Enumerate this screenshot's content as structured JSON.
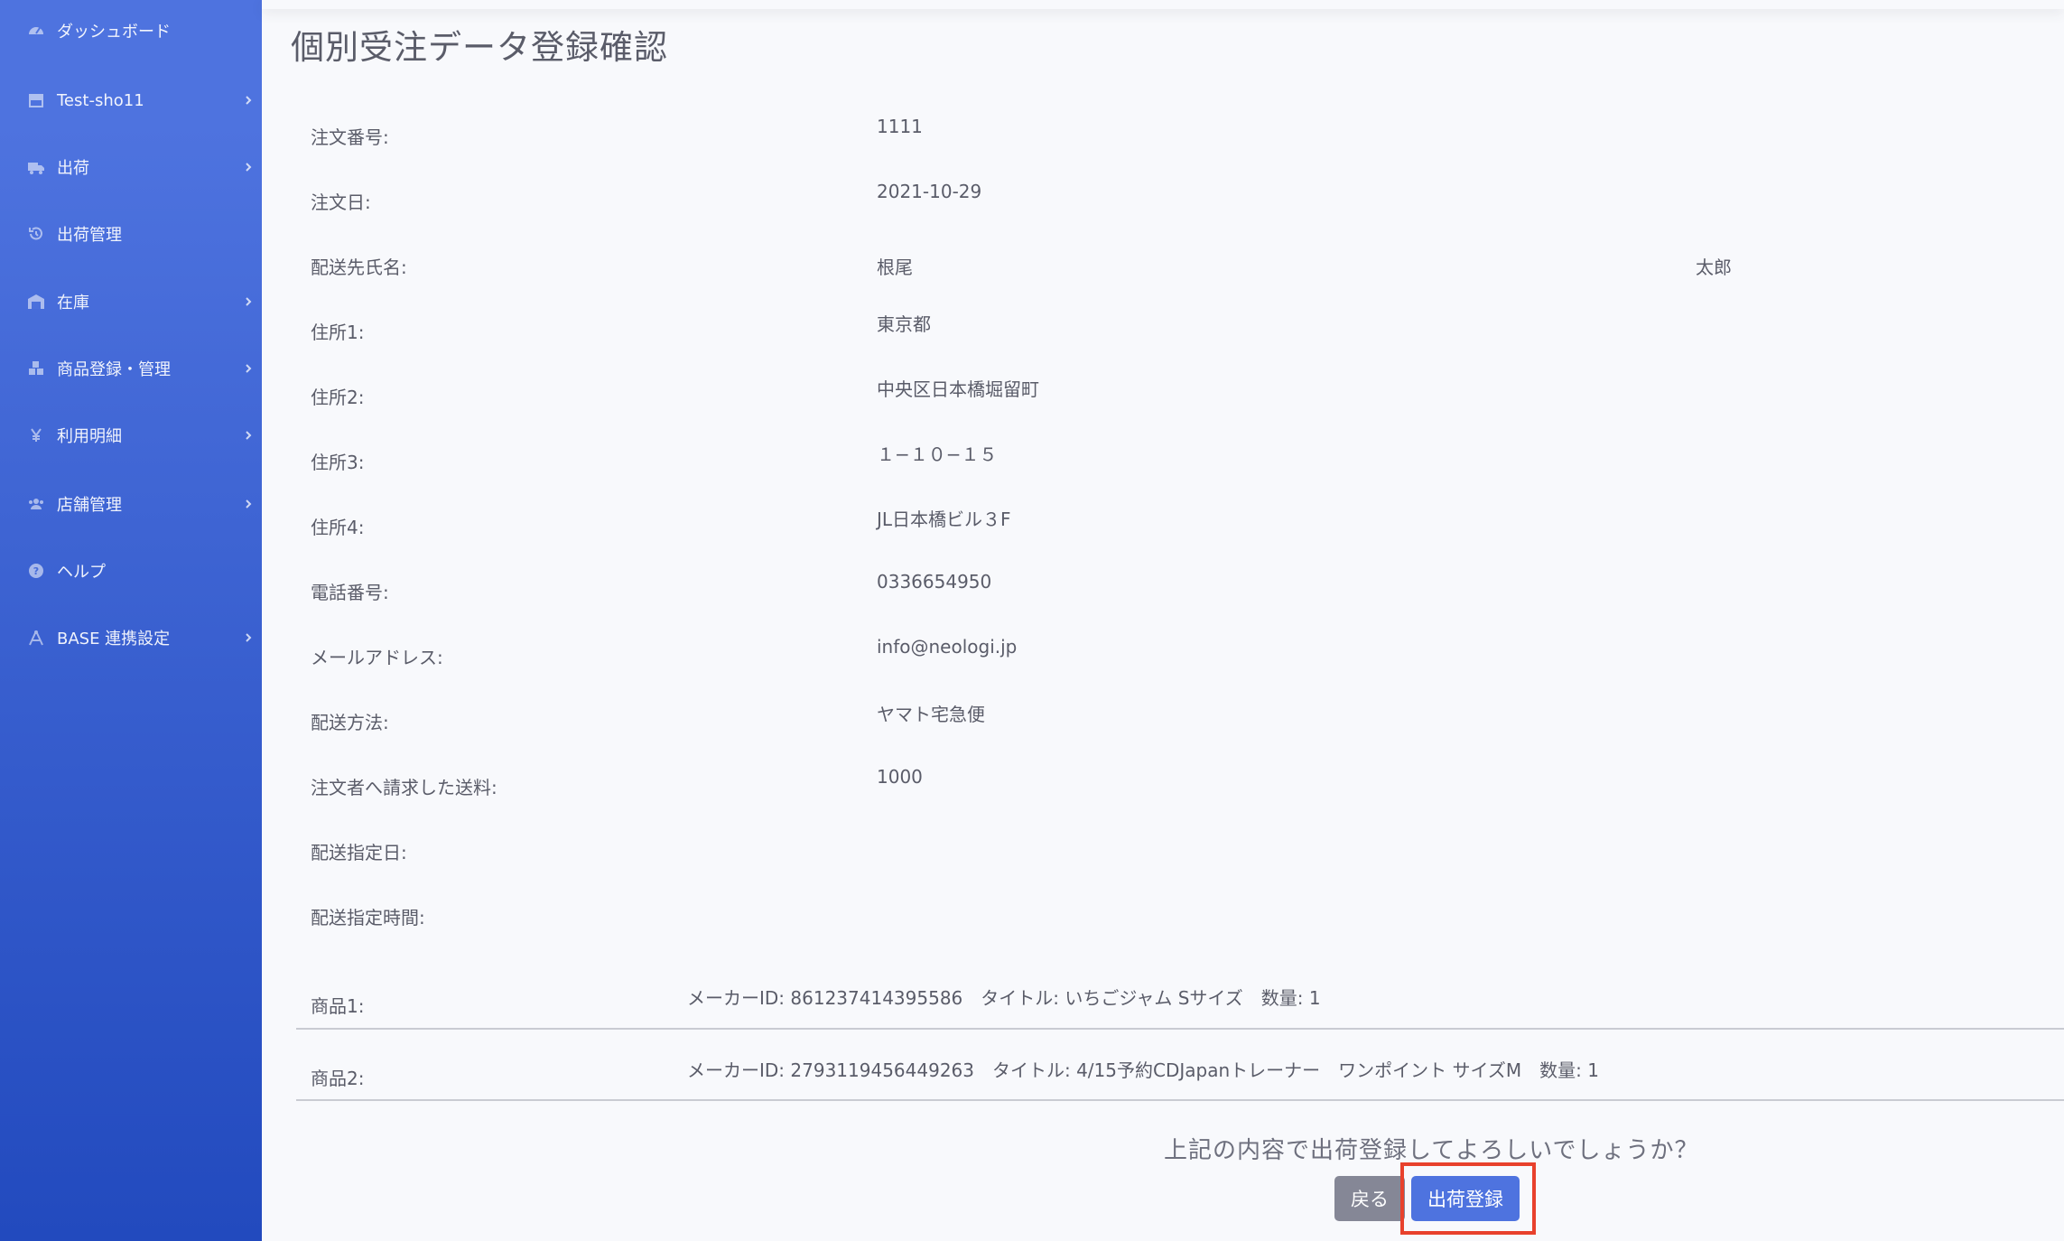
{
  "sidebar": {
    "items": [
      {
        "label": "ダッシュボード",
        "icon": "dashboard-icon",
        "has_submenu": false
      },
      {
        "label": "Test-sho11",
        "icon": "store-icon",
        "has_submenu": true
      },
      {
        "label": "出荷",
        "icon": "truck-icon",
        "has_submenu": true
      },
      {
        "label": "出荷管理",
        "icon": "history-icon",
        "has_submenu": false
      },
      {
        "label": "在庫",
        "icon": "warehouse-icon",
        "has_submenu": true
      },
      {
        "label": "商品登録・管理",
        "icon": "boxes-icon",
        "has_submenu": true
      },
      {
        "label": "利用明細",
        "icon": "yen-icon",
        "has_submenu": true
      },
      {
        "label": "店舗管理",
        "icon": "users-icon",
        "has_submenu": true
      },
      {
        "label": "ヘルプ",
        "icon": "question-circle-icon",
        "has_submenu": false
      },
      {
        "label": "BASE 連携設定",
        "icon": "drafting-compass-icon",
        "has_submenu": true
      }
    ]
  },
  "page": {
    "title": "個別受注データ登録確認"
  },
  "form": {
    "order_number_label": "注文番号:",
    "order_number": "1111",
    "order_date_label": "注文日:",
    "order_date": "2021-10-29",
    "recipient_label": "配送先氏名:",
    "recipient_last": "根尾",
    "recipient_first": "太郎",
    "address1_label": "住所1:",
    "address1": "東京都",
    "address2_label": "住所2:",
    "address2": "中央区日本橋堀留町",
    "address3_label": "住所3:",
    "address3": "１−１０−１５",
    "address4_label": "住所4:",
    "address4": "JL日本橋ビル３F",
    "phone_label": "電話番号:",
    "phone": "0336654950",
    "email_label": "メールアドレス:",
    "email": "info@neologi.jp",
    "shipping_method_label": "配送方法:",
    "shipping_method": "ヤマト宅急便",
    "shipping_fee_label": "注文者へ請求した送料:",
    "shipping_fee": "1000",
    "delivery_date_label": "配送指定日:",
    "delivery_date": "",
    "delivery_time_label": "配送指定時間:",
    "delivery_time": ""
  },
  "products": [
    {
      "label": "商品1:",
      "detail": "メーカーID: 861237414395586　タイトル: いちごジャム Sサイズ　数量: 1"
    },
    {
      "label": "商品2:",
      "detail": "メーカーID: 2793119456449263　タイトル: 4/15予約CDJapanトレーナー　ワンポイント サイズM　数量: 1"
    }
  ],
  "confirm": {
    "question": "上記の内容で出荷登録してよろしいでしょうか？",
    "back_label": "戻る",
    "submit_label": "出荷登録"
  },
  "colors": {
    "sidebar_top": "#4e73df",
    "sidebar_bottom": "#224abe",
    "primary": "#4e73df",
    "secondary": "#858796",
    "highlight": "#e8412c"
  }
}
